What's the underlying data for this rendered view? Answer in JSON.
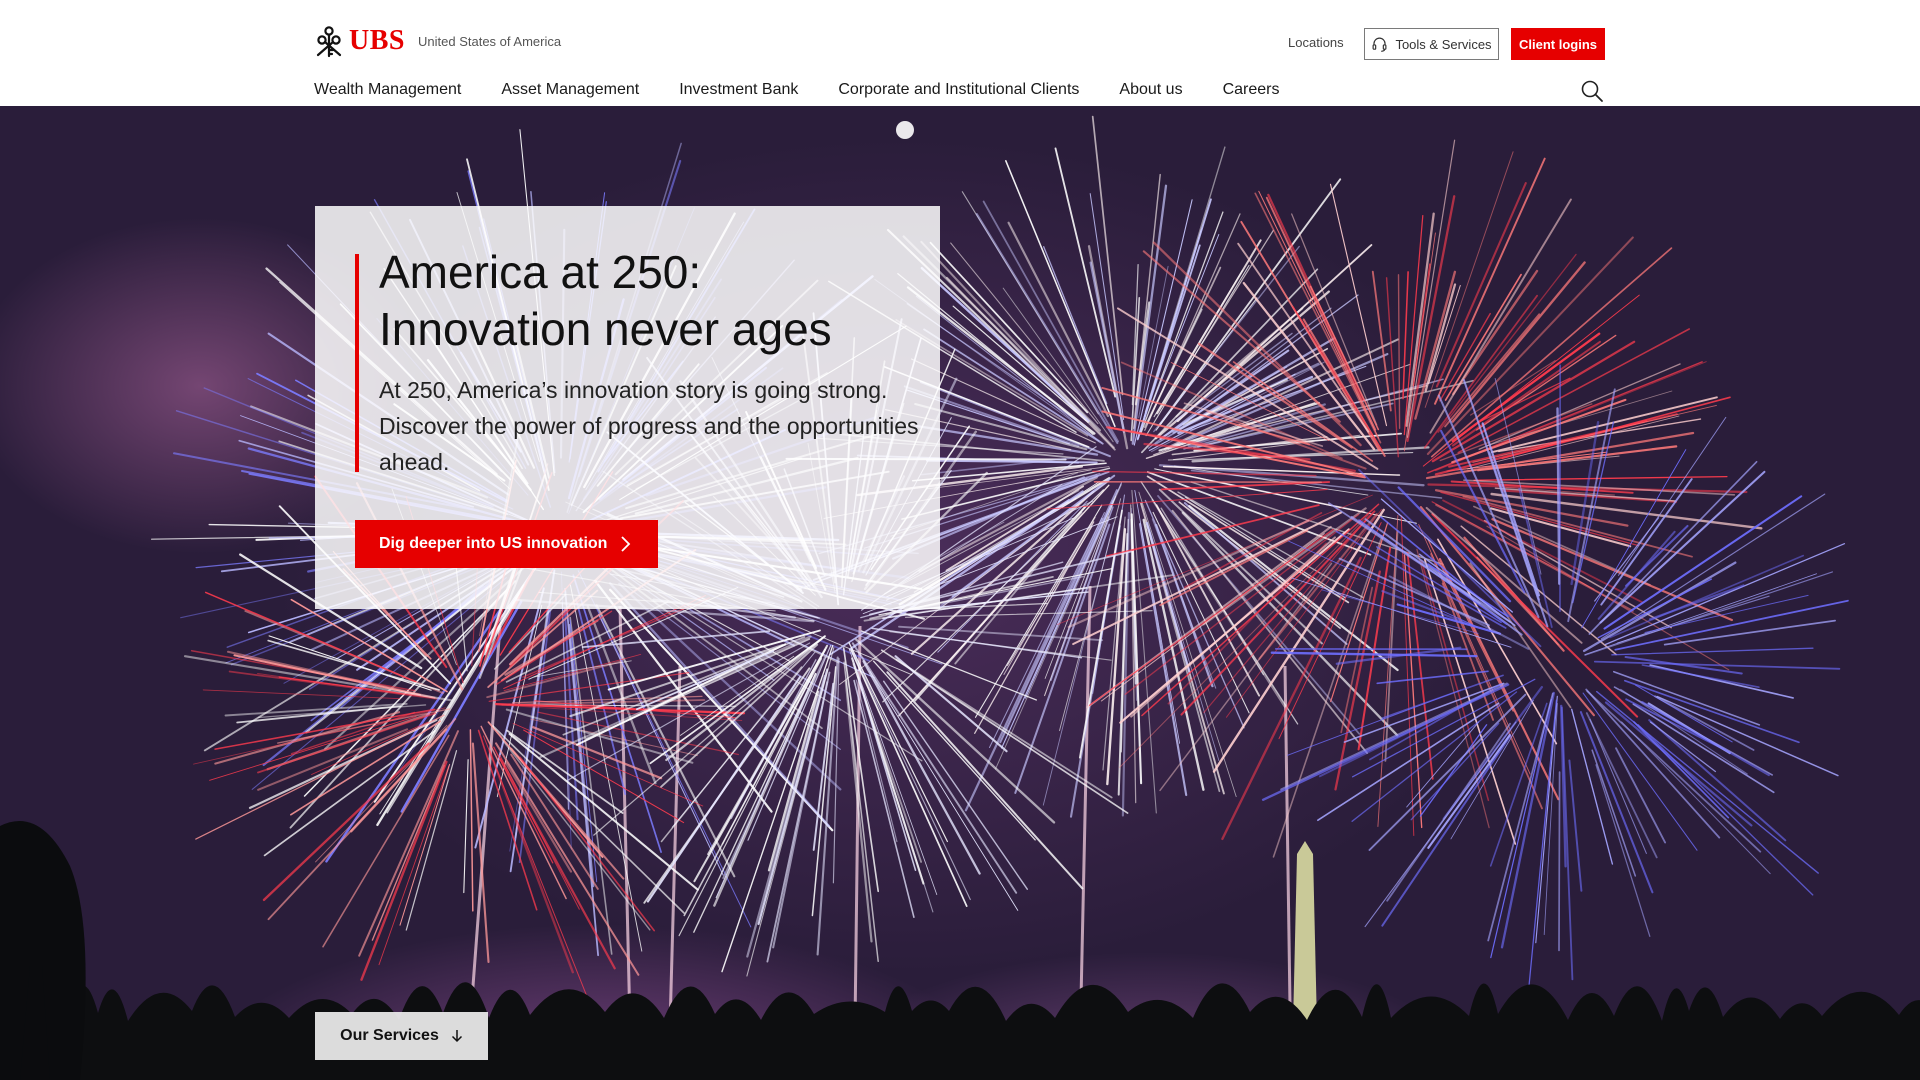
{
  "header": {
    "logo_text": "UBS",
    "region": "United States of America",
    "locations": "Locations",
    "tools_label": "Tools & Services",
    "login_label": "Client logins"
  },
  "nav": {
    "items": [
      {
        "label": "Wealth Management"
      },
      {
        "label": "Asset Management"
      },
      {
        "label": "Investment Bank"
      },
      {
        "label": "Corporate and Institutional Clients"
      },
      {
        "label": "About us"
      },
      {
        "label": "Careers"
      }
    ]
  },
  "hero": {
    "title_line1": "America at 250:",
    "title_line2": "Innovation never ages",
    "text": "At 250, America’s innovation story is going strong. Discover the power of progress and the opportunities ahead.",
    "cta_label": "Dig deeper into US innovation",
    "services_label": "Our Services"
  },
  "icons": {
    "logo": "ubs-keys-icon",
    "tools": "headset-icon",
    "search": "search-icon",
    "cta": "chevron-right-icon",
    "services": "arrow-down-icon"
  },
  "colors": {
    "brand_red": "#e60000",
    "text_dark": "#111111",
    "hero_sky": "#2a1d3a"
  }
}
